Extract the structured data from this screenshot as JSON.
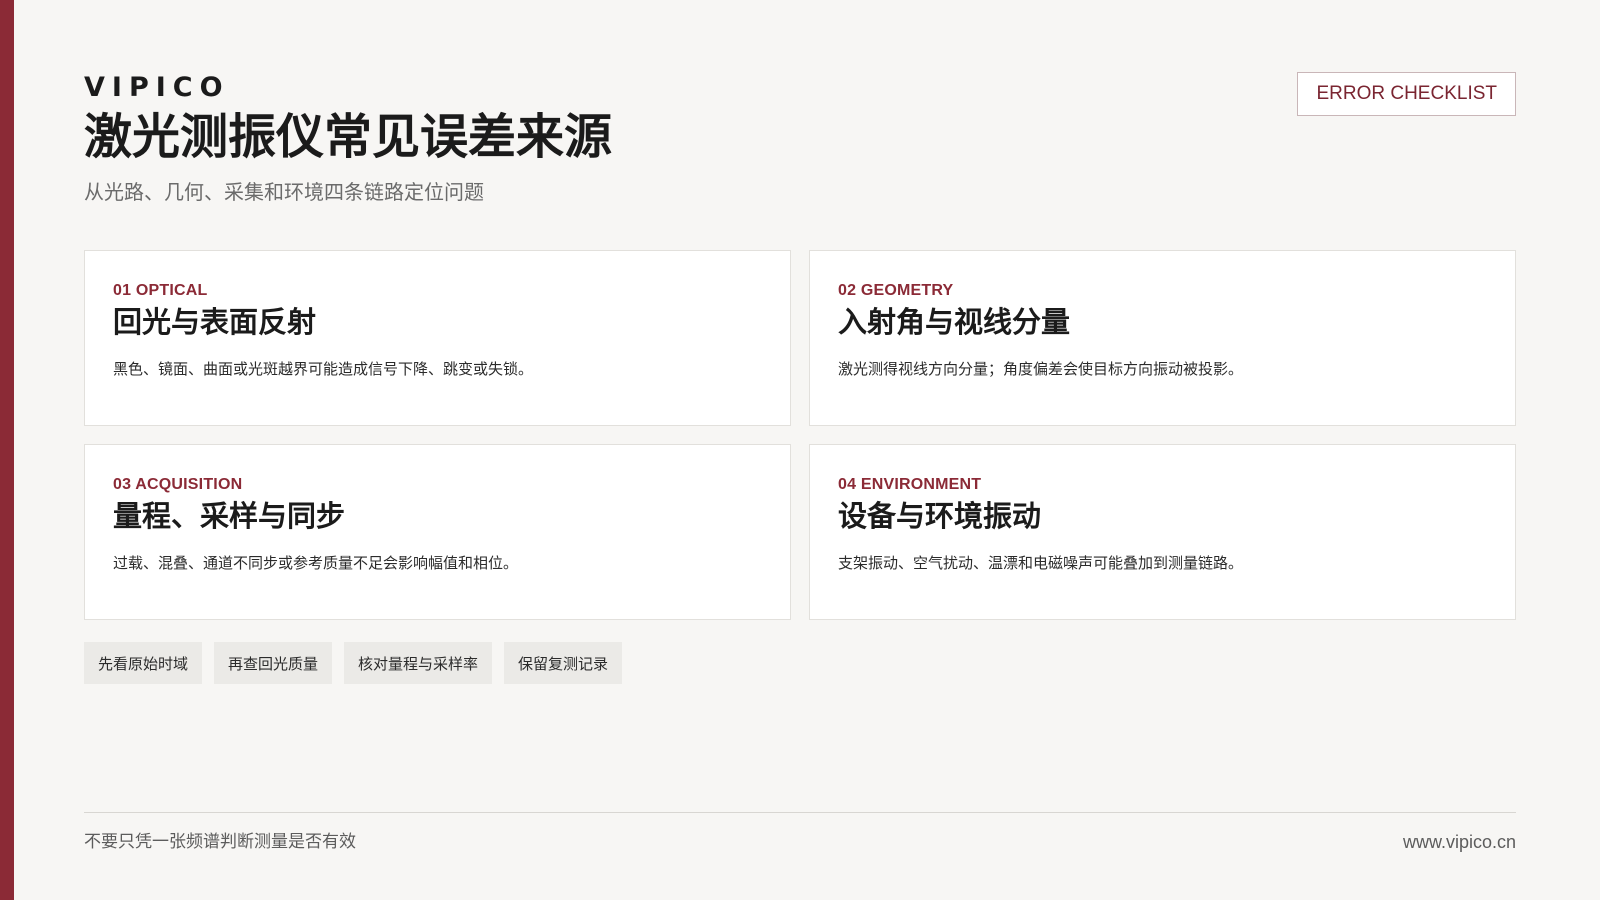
{
  "header": {
    "brand": "VIPICO",
    "title": "激光测振仪常见误差来源",
    "subtitle": "从光路、几何、采集和环境四条链路定位问题",
    "tag_label": "ERROR CHECKLIST"
  },
  "cards": [
    {
      "kicker": "01 OPTICAL",
      "title": "回光与表面反射",
      "description": "黑色、镜面、曲面或光斑越界可能造成信号下降、跳变或失锁。"
    },
    {
      "kicker": "02 GEOMETRY",
      "title": "入射角与视线分量",
      "description": "激光测得视线方向分量；角度偏差会使目标方向振动被投影。"
    },
    {
      "kicker": "03 ACQUISITION",
      "title": "量程、采样与同步",
      "description": "过载、混叠、通道不同步或参考质量不足会影响幅值和相位。"
    },
    {
      "kicker": "04 ENVIRONMENT",
      "title": "设备与环境振动",
      "description": "支架振动、空气扰动、温漂和电磁噪声可能叠加到测量链路。"
    }
  ],
  "chips": [
    {
      "label": "先看原始时域"
    },
    {
      "label": "再查回光质量"
    },
    {
      "label": "核对量程与采样率"
    },
    {
      "label": "保留复测记录"
    }
  ],
  "footer": {
    "note": "不要只凭一张频谱判断测量是否有效",
    "url": "www.vipico.cn"
  },
  "colors": {
    "accent": "#8b2a36",
    "background": "#f7f6f4",
    "card": "#ffffff",
    "chip": "#ebeae7"
  }
}
